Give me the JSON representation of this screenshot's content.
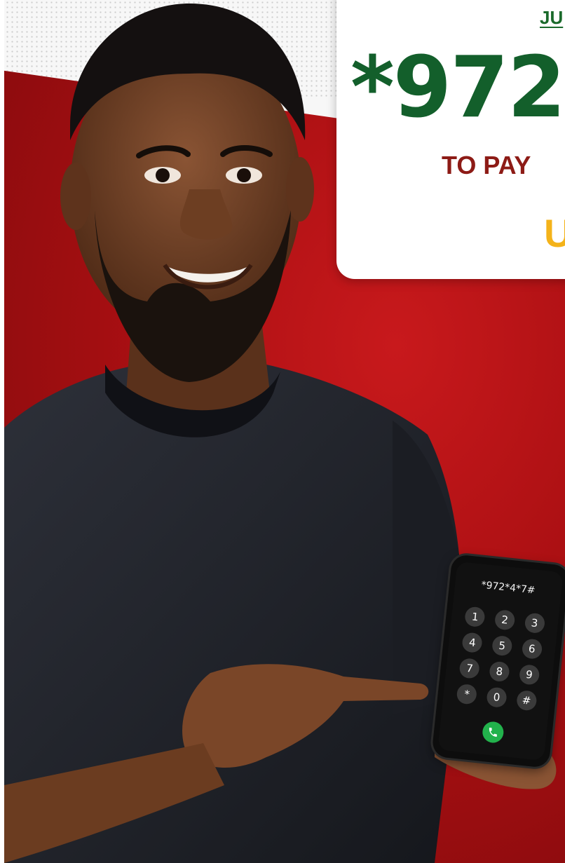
{
  "promo": {
    "top_text": "JU",
    "code": "*972",
    "subtitle": "TO PAY",
    "cta": "U"
  },
  "phone": {
    "dialed": "*972*4*7#",
    "keys": [
      "1",
      "2",
      "3",
      "4",
      "5",
      "6",
      "7",
      "8",
      "9",
      "*",
      "0",
      "#"
    ]
  },
  "colors": {
    "background_red": "#b01417",
    "code_green": "#135f2b",
    "subtitle_red": "#8d1b16",
    "cta_yellow": "#f4b31a",
    "call_green": "#22b24c"
  }
}
